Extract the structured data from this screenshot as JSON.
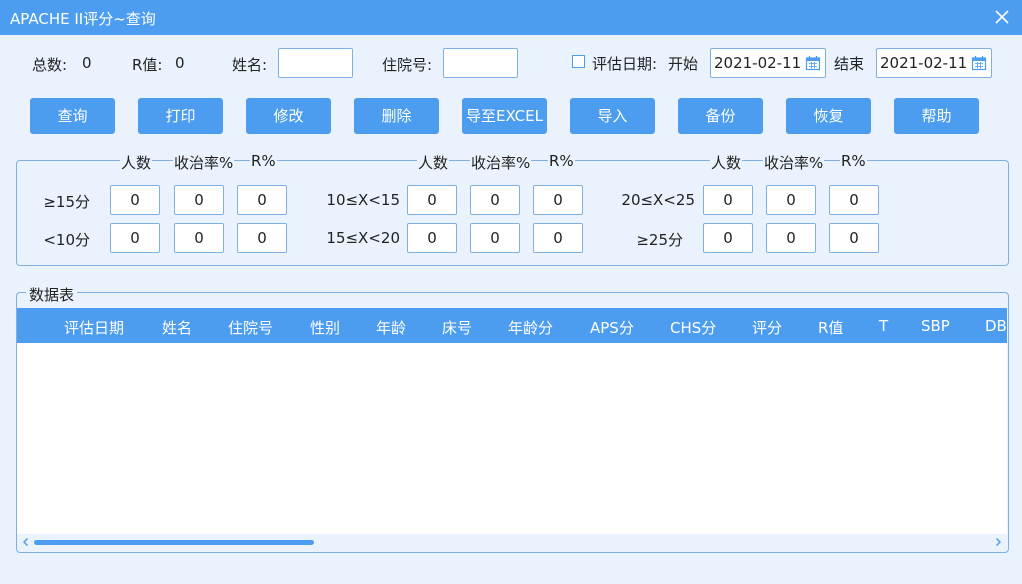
{
  "window": {
    "title": "APACHE II评分~查询"
  },
  "summary": {
    "total_label": "总数:",
    "total_value": "0",
    "r_label": "R值:",
    "r_value": "0"
  },
  "filters": {
    "name_label": "姓名:",
    "name_value": "",
    "admission_label": "住院号:",
    "admission_value": "",
    "date_checkbox_label": "评估日期:",
    "start_label": "开始",
    "start_date": "2021-02-11",
    "end_label": "结束",
    "end_date": "2021-02-11"
  },
  "toolbar": {
    "query": "查询",
    "print": "打印",
    "edit": "修改",
    "delete": "删除",
    "export_excel": "导至EXCEL",
    "import": "导入",
    "backup": "备份",
    "restore": "恢复",
    "help": "帮助"
  },
  "stats": {
    "col_headers": [
      "人数",
      "收治率%",
      "R%"
    ],
    "groups": [
      {
        "rows": [
          {
            "label": "≥15分",
            "values": [
              "0",
              "0",
              "0"
            ]
          },
          {
            "label": "<10分",
            "values": [
              "0",
              "0",
              "0"
            ]
          }
        ]
      },
      {
        "rows": [
          {
            "label": "10≤X<15",
            "values": [
              "0",
              "0",
              "0"
            ]
          },
          {
            "label": "15≤X<20",
            "values": [
              "0",
              "0",
              "0"
            ]
          }
        ]
      },
      {
        "rows": [
          {
            "label": "20≤X<25",
            "values": [
              "0",
              "0",
              "0"
            ]
          },
          {
            "label": "≥25分",
            "values": [
              "0",
              "0",
              "0"
            ]
          }
        ]
      }
    ]
  },
  "datatable": {
    "legend": "数据表",
    "columns": [
      "评估日期",
      "姓名",
      "住院号",
      "性别",
      "年龄",
      "床号",
      "年龄分",
      "APS分",
      "CHS分",
      "评分",
      "R值",
      "T",
      "SBP",
      "DB"
    ]
  },
  "icons": {
    "close": "close-icon",
    "calendar": "calendar-icon",
    "scroll_left": "chevron-left-icon",
    "scroll_right": "chevron-right-icon"
  },
  "colors": {
    "accent": "#4c9df0",
    "background": "#e9f2fd",
    "border": "#7fb0e0"
  }
}
